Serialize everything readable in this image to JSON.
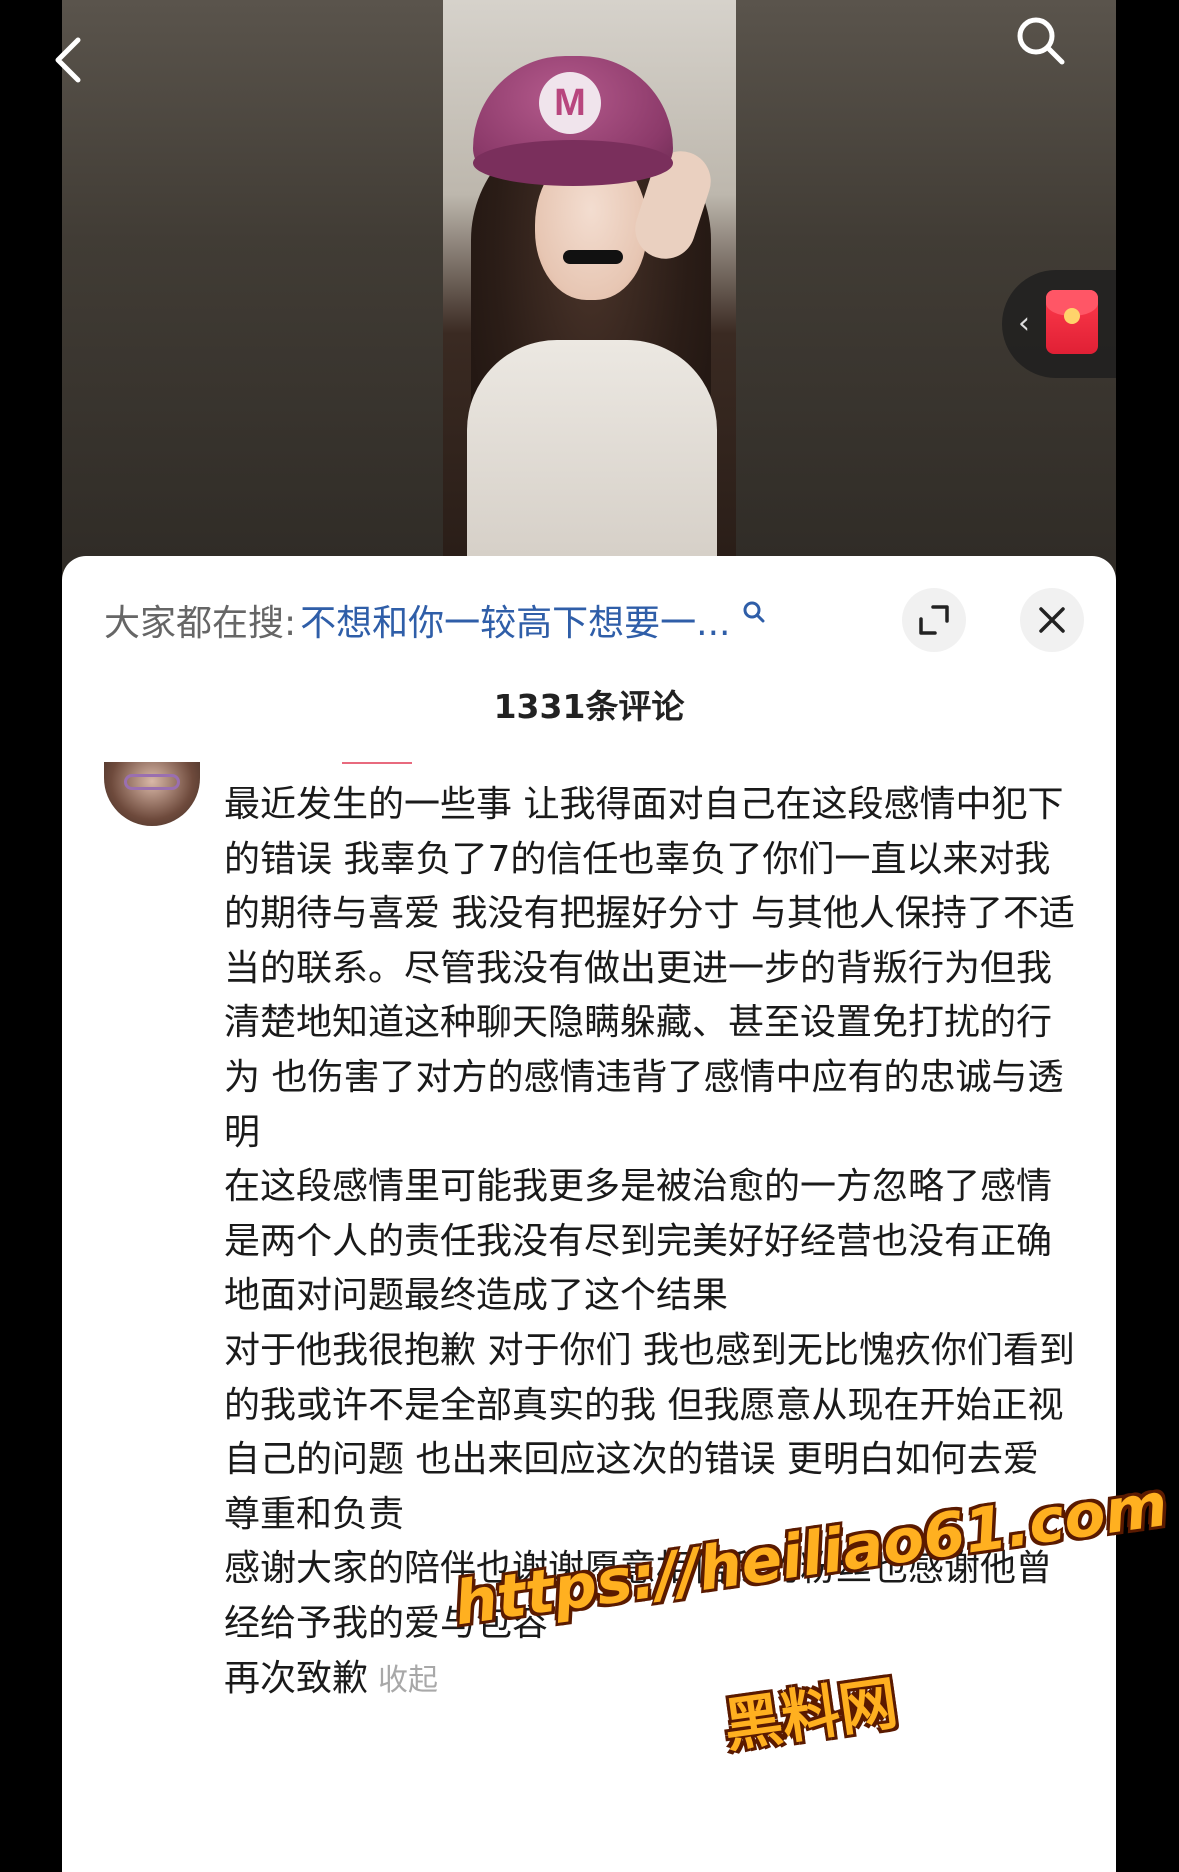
{
  "header": {
    "back_icon": "chevron-left-icon",
    "search_icon": "search-icon"
  },
  "video": {
    "cap_badge_letter": "M"
  },
  "red_packet": {
    "icon": "red-envelope-icon",
    "chevron_icon": "chevron-left-icon"
  },
  "comments_sheet": {
    "trending_prefix": "大家都在搜:",
    "trending_query": "不想和你一较高下想要一...",
    "trending_icon": "search-icon",
    "expand_icon": "expand-icon",
    "close_icon": "close-icon",
    "comment_count": "1331条评论",
    "comment": {
      "text": "最近发生的一些事 让我得面对自己在这段感情中犯下的错误 我辜负了7的信任也辜负了你们一直以来对我的期待与喜爱 我没有把握好分寸 与其他人保持了不适当的联系。尽管我没有做出更进一步的背叛行为但我清楚地知道这种聊天隐瞒躲藏、甚至设置免打扰的行为 也伤害了对方的感情违背了感情中应有的忠诚与透明\n在这段感情里可能我更多是被治愈的一方忽略了感情是两个人的责任我没有尽到完美好好经营也没有正确地面对问题最终造成了这个结果\n对于他我很抱歉 对于你们 我也感到无比愧疚你们看到的我或许不是全部真实的我  但我愿意从现在开始正视自己的问题 也出来回应这次的错误 更明白如何去爱 尊重和负责\n感谢大家的陪伴也谢谢愿意相信我的粉丝也感谢他曾经给予我的爱与包容\n再次致歉",
      "collapse_label": "收起"
    }
  },
  "watermark": {
    "url": "https://heiliao61.com",
    "name": "黑料网"
  }
}
